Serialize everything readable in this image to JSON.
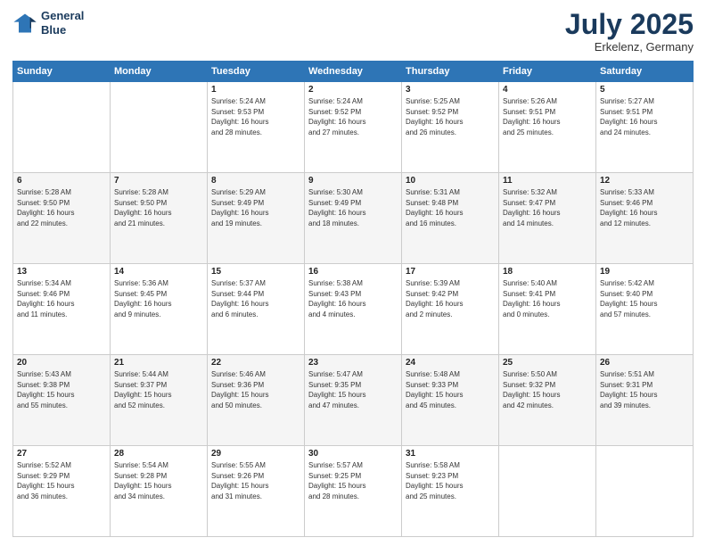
{
  "logo": {
    "line1": "General",
    "line2": "Blue"
  },
  "title": "July 2025",
  "subtitle": "Erkelenz, Germany",
  "days": [
    "Sunday",
    "Monday",
    "Tuesday",
    "Wednesday",
    "Thursday",
    "Friday",
    "Saturday"
  ],
  "weeks": [
    [
      {
        "day": "",
        "content": ""
      },
      {
        "day": "",
        "content": ""
      },
      {
        "day": "1",
        "content": "Sunrise: 5:24 AM\nSunset: 9:53 PM\nDaylight: 16 hours\nand 28 minutes."
      },
      {
        "day": "2",
        "content": "Sunrise: 5:24 AM\nSunset: 9:52 PM\nDaylight: 16 hours\nand 27 minutes."
      },
      {
        "day": "3",
        "content": "Sunrise: 5:25 AM\nSunset: 9:52 PM\nDaylight: 16 hours\nand 26 minutes."
      },
      {
        "day": "4",
        "content": "Sunrise: 5:26 AM\nSunset: 9:51 PM\nDaylight: 16 hours\nand 25 minutes."
      },
      {
        "day": "5",
        "content": "Sunrise: 5:27 AM\nSunset: 9:51 PM\nDaylight: 16 hours\nand 24 minutes."
      }
    ],
    [
      {
        "day": "6",
        "content": "Sunrise: 5:28 AM\nSunset: 9:50 PM\nDaylight: 16 hours\nand 22 minutes."
      },
      {
        "day": "7",
        "content": "Sunrise: 5:28 AM\nSunset: 9:50 PM\nDaylight: 16 hours\nand 21 minutes."
      },
      {
        "day": "8",
        "content": "Sunrise: 5:29 AM\nSunset: 9:49 PM\nDaylight: 16 hours\nand 19 minutes."
      },
      {
        "day": "9",
        "content": "Sunrise: 5:30 AM\nSunset: 9:49 PM\nDaylight: 16 hours\nand 18 minutes."
      },
      {
        "day": "10",
        "content": "Sunrise: 5:31 AM\nSunset: 9:48 PM\nDaylight: 16 hours\nand 16 minutes."
      },
      {
        "day": "11",
        "content": "Sunrise: 5:32 AM\nSunset: 9:47 PM\nDaylight: 16 hours\nand 14 minutes."
      },
      {
        "day": "12",
        "content": "Sunrise: 5:33 AM\nSunset: 9:46 PM\nDaylight: 16 hours\nand 12 minutes."
      }
    ],
    [
      {
        "day": "13",
        "content": "Sunrise: 5:34 AM\nSunset: 9:46 PM\nDaylight: 16 hours\nand 11 minutes."
      },
      {
        "day": "14",
        "content": "Sunrise: 5:36 AM\nSunset: 9:45 PM\nDaylight: 16 hours\nand 9 minutes."
      },
      {
        "day": "15",
        "content": "Sunrise: 5:37 AM\nSunset: 9:44 PM\nDaylight: 16 hours\nand 6 minutes."
      },
      {
        "day": "16",
        "content": "Sunrise: 5:38 AM\nSunset: 9:43 PM\nDaylight: 16 hours\nand 4 minutes."
      },
      {
        "day": "17",
        "content": "Sunrise: 5:39 AM\nSunset: 9:42 PM\nDaylight: 16 hours\nand 2 minutes."
      },
      {
        "day": "18",
        "content": "Sunrise: 5:40 AM\nSunset: 9:41 PM\nDaylight: 16 hours\nand 0 minutes."
      },
      {
        "day": "19",
        "content": "Sunrise: 5:42 AM\nSunset: 9:40 PM\nDaylight: 15 hours\nand 57 minutes."
      }
    ],
    [
      {
        "day": "20",
        "content": "Sunrise: 5:43 AM\nSunset: 9:38 PM\nDaylight: 15 hours\nand 55 minutes."
      },
      {
        "day": "21",
        "content": "Sunrise: 5:44 AM\nSunset: 9:37 PM\nDaylight: 15 hours\nand 52 minutes."
      },
      {
        "day": "22",
        "content": "Sunrise: 5:46 AM\nSunset: 9:36 PM\nDaylight: 15 hours\nand 50 minutes."
      },
      {
        "day": "23",
        "content": "Sunrise: 5:47 AM\nSunset: 9:35 PM\nDaylight: 15 hours\nand 47 minutes."
      },
      {
        "day": "24",
        "content": "Sunrise: 5:48 AM\nSunset: 9:33 PM\nDaylight: 15 hours\nand 45 minutes."
      },
      {
        "day": "25",
        "content": "Sunrise: 5:50 AM\nSunset: 9:32 PM\nDaylight: 15 hours\nand 42 minutes."
      },
      {
        "day": "26",
        "content": "Sunrise: 5:51 AM\nSunset: 9:31 PM\nDaylight: 15 hours\nand 39 minutes."
      }
    ],
    [
      {
        "day": "27",
        "content": "Sunrise: 5:52 AM\nSunset: 9:29 PM\nDaylight: 15 hours\nand 36 minutes."
      },
      {
        "day": "28",
        "content": "Sunrise: 5:54 AM\nSunset: 9:28 PM\nDaylight: 15 hours\nand 34 minutes."
      },
      {
        "day": "29",
        "content": "Sunrise: 5:55 AM\nSunset: 9:26 PM\nDaylight: 15 hours\nand 31 minutes."
      },
      {
        "day": "30",
        "content": "Sunrise: 5:57 AM\nSunset: 9:25 PM\nDaylight: 15 hours\nand 28 minutes."
      },
      {
        "day": "31",
        "content": "Sunrise: 5:58 AM\nSunset: 9:23 PM\nDaylight: 15 hours\nand 25 minutes."
      },
      {
        "day": "",
        "content": ""
      },
      {
        "day": "",
        "content": ""
      }
    ]
  ]
}
